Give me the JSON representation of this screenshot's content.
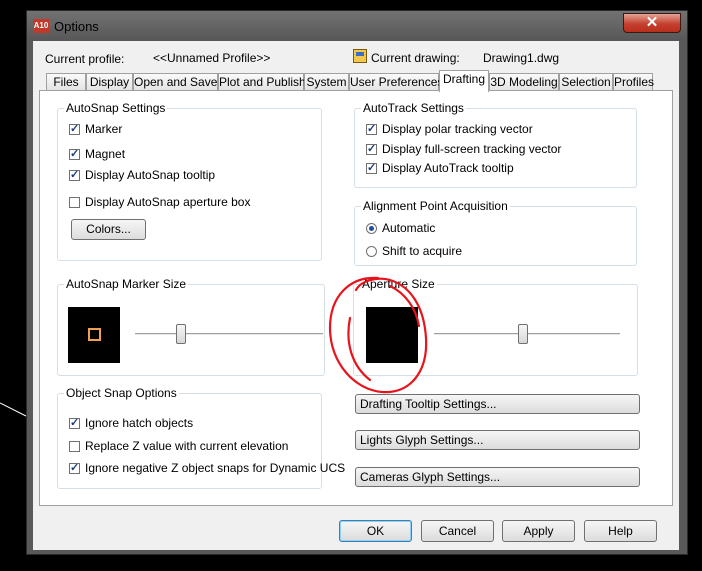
{
  "window": {
    "title": "Options",
    "app_icon_text": "A10",
    "close_label": "✕"
  },
  "header": {
    "current_profile_label": "Current profile:",
    "current_profile_value": "<<Unnamed Profile>>",
    "current_drawing_label": "Current drawing:",
    "current_drawing_value": "Drawing1.dwg"
  },
  "tabs": [
    {
      "label": "Files"
    },
    {
      "label": "Display"
    },
    {
      "label": "Open and Save"
    },
    {
      "label": "Plot and Publish"
    },
    {
      "label": "System"
    },
    {
      "label": "User Preferences"
    },
    {
      "label": "Drafting",
      "active": true
    },
    {
      "label": "3D Modeling"
    },
    {
      "label": "Selection"
    },
    {
      "label": "Profiles"
    }
  ],
  "autosnap": {
    "title": "AutoSnap Settings",
    "items": [
      {
        "label": "Marker",
        "checked": true
      },
      {
        "label": "Magnet",
        "checked": true
      },
      {
        "label": "Display AutoSnap tooltip",
        "checked": true
      },
      {
        "label": "Display AutoSnap aperture box",
        "checked": false
      }
    ],
    "colors_button": "Colors..."
  },
  "autotrack": {
    "title": "AutoTrack Settings",
    "items": [
      {
        "label": "Display polar tracking vector",
        "checked": true
      },
      {
        "label": "Display full-screen tracking vector",
        "checked": true
      },
      {
        "label": "Display AutoTrack tooltip",
        "checked": true
      }
    ]
  },
  "alignment": {
    "title": "Alignment Point Acquisition",
    "options": [
      {
        "label": "Automatic",
        "selected": true
      },
      {
        "label": "Shift to acquire",
        "selected": false
      }
    ]
  },
  "marker_size": {
    "title": "AutoSnap Marker Size",
    "slider_fraction": 0.23
  },
  "aperture_size": {
    "title": "Aperture Size",
    "slider_fraction": 0.48
  },
  "osnap": {
    "title": "Object Snap Options",
    "items": [
      {
        "label": "Ignore hatch objects",
        "checked": true
      },
      {
        "label": "Replace Z value with current elevation",
        "checked": false
      },
      {
        "label": "Ignore negative Z object snaps for Dynamic UCS",
        "checked": true
      }
    ]
  },
  "settings_buttons": {
    "drafting_tooltip": "Drafting Tooltip Settings...",
    "lights_glyph": "Lights Glyph Settings...",
    "cameras_glyph": "Cameras Glyph Settings..."
  },
  "footer": {
    "ok": "OK",
    "cancel": "Cancel",
    "apply": "Apply",
    "help": "Help"
  },
  "annotation": {
    "color": "#e8141c"
  },
  "colors": {
    "accent": "#3c7fb1",
    "marker_preview_box": "#f0a050"
  }
}
